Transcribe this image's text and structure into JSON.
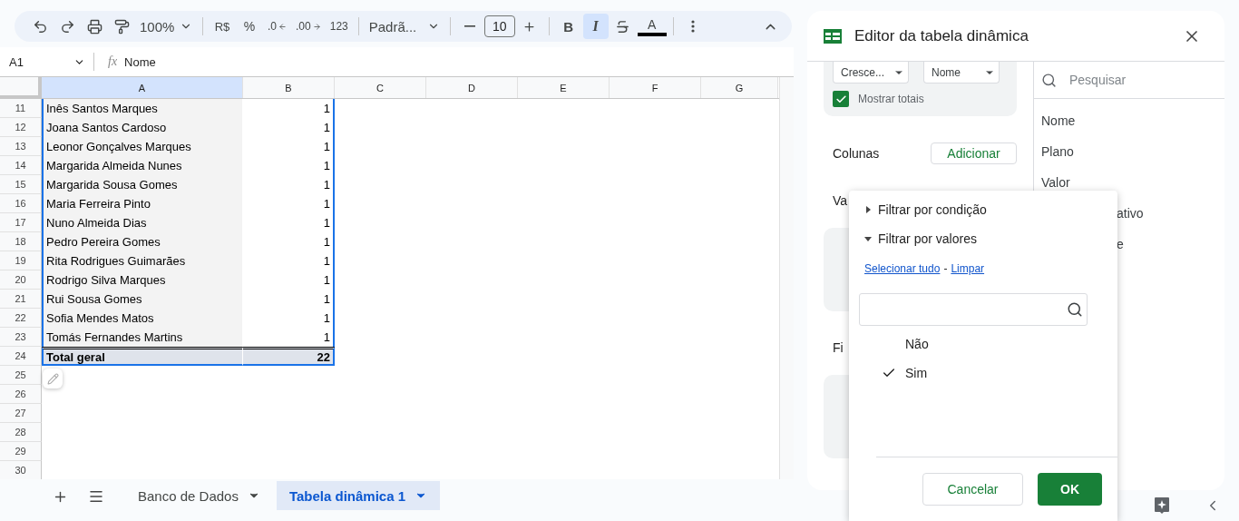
{
  "toolbar": {
    "zoom": "100%",
    "currency": "R$",
    "percent": "%",
    "dec_less": ".0",
    "dec_more": ".00",
    "number_format": "123",
    "font": "Padrã...",
    "font_size": "10",
    "bold": {
      "label": "B",
      "on": false
    },
    "italic": {
      "label": "I",
      "on": true
    },
    "text_color": "A"
  },
  "formula_bar": {
    "cell": "A1",
    "fx": "fx",
    "content": "Nome"
  },
  "columns": [
    {
      "label": "A",
      "selected": true
    },
    {
      "label": "B",
      "selected": false
    },
    {
      "label": "C",
      "selected": false
    },
    {
      "label": "D",
      "selected": false
    },
    {
      "label": "E",
      "selected": false
    },
    {
      "label": "F",
      "selected": false
    },
    {
      "label": "G",
      "selected": false
    }
  ],
  "rows": [
    {
      "num": "11",
      "kind": "data",
      "name": "Inês Santos Marques",
      "count": "1"
    },
    {
      "num": "12",
      "kind": "data",
      "name": "Joana Santos Cardoso",
      "count": "1"
    },
    {
      "num": "13",
      "kind": "data",
      "name": "Leonor Gonçalves Marques",
      "count": "1"
    },
    {
      "num": "14",
      "kind": "data",
      "name": "Margarida Almeida Nunes",
      "count": "1"
    },
    {
      "num": "15",
      "kind": "data",
      "name": "Margarida Sousa Gomes",
      "count": "1"
    },
    {
      "num": "16",
      "kind": "data",
      "name": "Maria Ferreira Pinto",
      "count": "1"
    },
    {
      "num": "17",
      "kind": "data",
      "name": "Nuno Almeida Dias",
      "count": "1"
    },
    {
      "num": "18",
      "kind": "data",
      "name": "Pedro Pereira Gomes",
      "count": "1"
    },
    {
      "num": "19",
      "kind": "data",
      "name": "Rita Rodrigues Guimarães",
      "count": "1"
    },
    {
      "num": "20",
      "kind": "data",
      "name": "Rodrigo Silva Marques",
      "count": "1"
    },
    {
      "num": "21",
      "kind": "data",
      "name": "Rui Sousa Gomes",
      "count": "1"
    },
    {
      "num": "22",
      "kind": "data",
      "name": "Sofia Mendes Matos",
      "count": "1"
    },
    {
      "num": "23",
      "kind": "data",
      "name": "Tomás Fernandes Martins",
      "count": "1"
    },
    {
      "num": "24",
      "kind": "total",
      "name": "Total geral",
      "count": "22"
    },
    {
      "num": "25",
      "kind": "empty"
    },
    {
      "num": "26",
      "kind": "empty"
    },
    {
      "num": "27",
      "kind": "empty"
    },
    {
      "num": "28",
      "kind": "empty"
    },
    {
      "num": "29",
      "kind": "empty"
    },
    {
      "num": "30",
      "kind": "empty"
    }
  ],
  "sheet_tabs": [
    {
      "label": "Banco de Dados",
      "selected": false
    },
    {
      "label": "Tabela dinâmica 1",
      "selected": true
    }
  ],
  "pivot_editor": {
    "title": "Editor da tabela dinâmica",
    "sort_order": "Cresce...",
    "sort_by": "Nome",
    "show_totals": {
      "label": "Mostrar totais",
      "checked": true
    },
    "columns_label": "Colunas",
    "add_button": "Adicionar",
    "values_label": "Va",
    "filters_label": "Fi",
    "search": {
      "placeholder": "Pesquisar"
    },
    "fields": [
      {
        "label": "Nome",
        "kind": "full"
      },
      {
        "label": "Plano",
        "kind": "full"
      },
      {
        "label": "Valor",
        "kind": "full"
      },
      {
        "label": "ativo",
        "kind": "cut"
      },
      {
        "label": "e",
        "kind": "cut"
      }
    ]
  },
  "filter_menu": {
    "sections": [
      {
        "label": "Filtrar por condição",
        "expanded": false
      },
      {
        "label": "Filtrar por valores",
        "expanded": true
      }
    ],
    "select_all": "Selecionar tudo",
    "separator": "-",
    "clear": "Limpar",
    "values": [
      {
        "label": "Não",
        "checked": false
      },
      {
        "label": "Sim",
        "checked": true
      }
    ],
    "cancel": "Cancelar",
    "ok": "OK"
  }
}
